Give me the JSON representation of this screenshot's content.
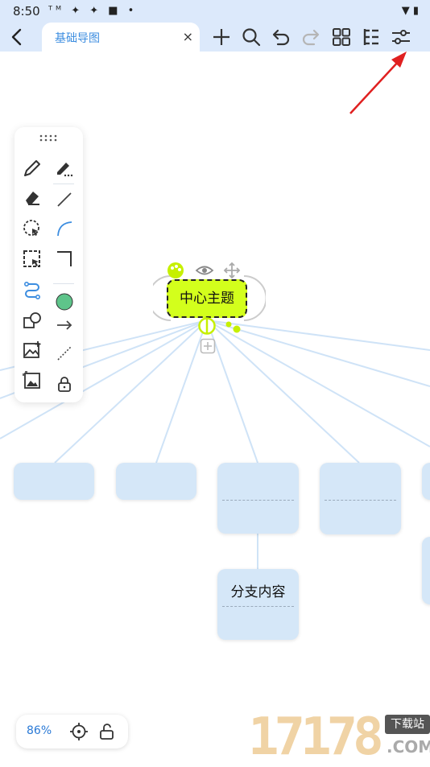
{
  "status_bar": {
    "time": "8:50",
    "left_icons": "ᵀᴹ ✦ ✦ ■ •",
    "right_icons": "▼ ▮"
  },
  "toolbar": {
    "tab_title": "基础导图",
    "close_glyph": "×",
    "icons": [
      "add-icon",
      "search-icon",
      "undo-icon",
      "redo-icon",
      "layout-grid-icon",
      "structure-icon",
      "settings-sliders-icon"
    ]
  },
  "mindmap": {
    "central_topic": "中心主题",
    "branch_label": "分支内容"
  },
  "palette": {
    "tools": [
      "pen-icon",
      "marker-icon",
      "eraser-icon",
      "line-icon",
      "lasso-select-icon",
      "curve-icon",
      "box-select-icon",
      "corner-line-icon",
      "connector-icon",
      "circle-shape-icon",
      "shape-icon",
      "arrow-line-icon",
      "insert-image-icon",
      "dashed-line-icon",
      "image-icon",
      "lock-icon"
    ],
    "colors": {
      "circle": "#5ec48a",
      "curve": "#3c8de0"
    }
  },
  "bottom_bar": {
    "zoom": "86%"
  },
  "watermark": {
    "digits": "17178",
    "badge": "下载站",
    "domain": ".COM"
  },
  "colors": {
    "accent": "#3c8de0",
    "topbar": "#dce9fb",
    "center_node": "#d3ff1c",
    "branch_node": "#d5e7f8",
    "annotation_arrow": "#e02020"
  }
}
